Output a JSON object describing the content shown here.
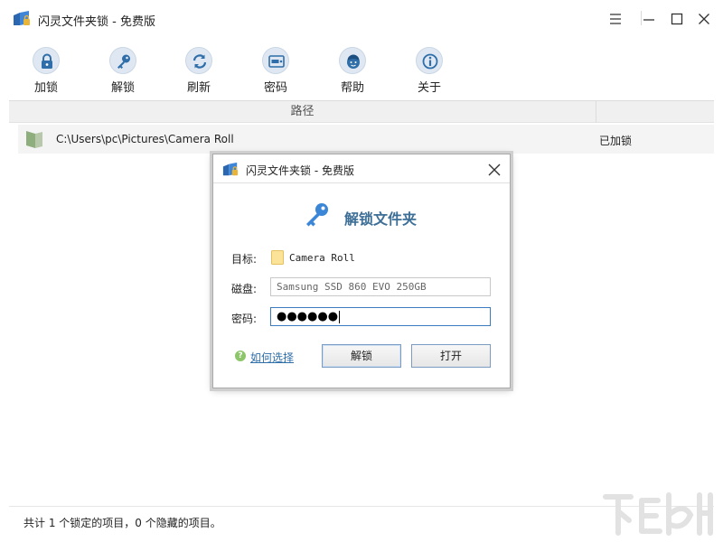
{
  "window": {
    "title": "闪灵文件夹锁 - 免费版"
  },
  "toolbar": {
    "items": [
      {
        "label": "加锁",
        "icon": "lock-icon"
      },
      {
        "label": "解锁",
        "icon": "key-icon"
      },
      {
        "label": "刷新",
        "icon": "refresh-icon"
      },
      {
        "label": "密码",
        "icon": "password-icon"
      },
      {
        "label": "帮助",
        "icon": "help-face-icon"
      },
      {
        "label": "关于",
        "icon": "info-icon"
      }
    ]
  },
  "table": {
    "column_header": "路径",
    "rows": [
      {
        "path": "C:\\Users\\pc\\Pictures\\Camera Roll",
        "status": "已加锁"
      }
    ]
  },
  "statusbar": {
    "text": "共计 1 个锁定的项目，0 个隐藏的项目。"
  },
  "dialog": {
    "title": "闪灵文件夹锁 - 免费版",
    "heading": "解锁文件夹",
    "target_label": "目标:",
    "target_value": "Camera Roll",
    "disk_label": "磁盘:",
    "disk_value": "Samsung SSD 860 EVO 250GB",
    "password_label": "密码:",
    "password_value": "●●●●●●",
    "help_link": "如何选择",
    "unlock_button": "解锁",
    "open_button": "打开"
  },
  "colors": {
    "accent": "#3d6f97",
    "link": "#2f6ea8",
    "focus_border": "#3b7bbf"
  }
}
